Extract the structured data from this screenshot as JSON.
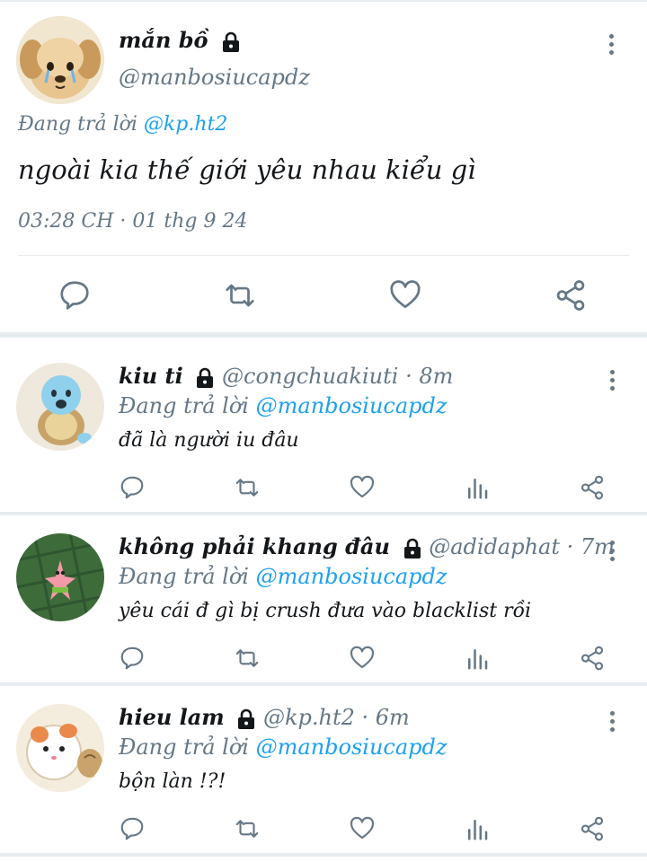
{
  "main_tweet": {
    "name": "mắn bồ",
    "handle": "@manbosiucapdz",
    "reply_prefix": "Đang trả lời",
    "reply_to": "@kp.ht2",
    "text": "ngoài kia thế giới yêu nhau kiểu gì",
    "timestamp": "03:28 CH · 01 thg 9 24"
  },
  "replies": [
    {
      "name": "kiu ti",
      "handle": "@congchuakiuti",
      "time": "· 8m",
      "reply_prefix": "Đang trả lời",
      "reply_to": "@manbosiucapdz",
      "text": "đã là người iu đâu"
    },
    {
      "name": "không phải khang đâu",
      "handle": "@adidaphat",
      "time": "· 7m",
      "reply_prefix": "Đang trả lời",
      "reply_to": "@manbosiucapdz",
      "text": "yêu cái đ gì bị crush đưa vào blacklist rồi"
    },
    {
      "name": "hieu lam",
      "handle": "@kp.ht2",
      "time": "· 6m",
      "reply_prefix": "Đang trả lời",
      "reply_to": "@manbosiucapdz",
      "text": "bộn làn !?!"
    }
  ],
  "icons": {
    "reply": "reply-icon",
    "retweet": "retweet-icon",
    "like": "like-icon",
    "analytics": "analytics-icon",
    "share": "share-icon",
    "more": "more-icon",
    "lock": "lock-icon"
  },
  "colors": {
    "text": "#14171a",
    "secondary": "#657786",
    "link": "#1da1f2",
    "divider": "#e6ecf0"
  }
}
